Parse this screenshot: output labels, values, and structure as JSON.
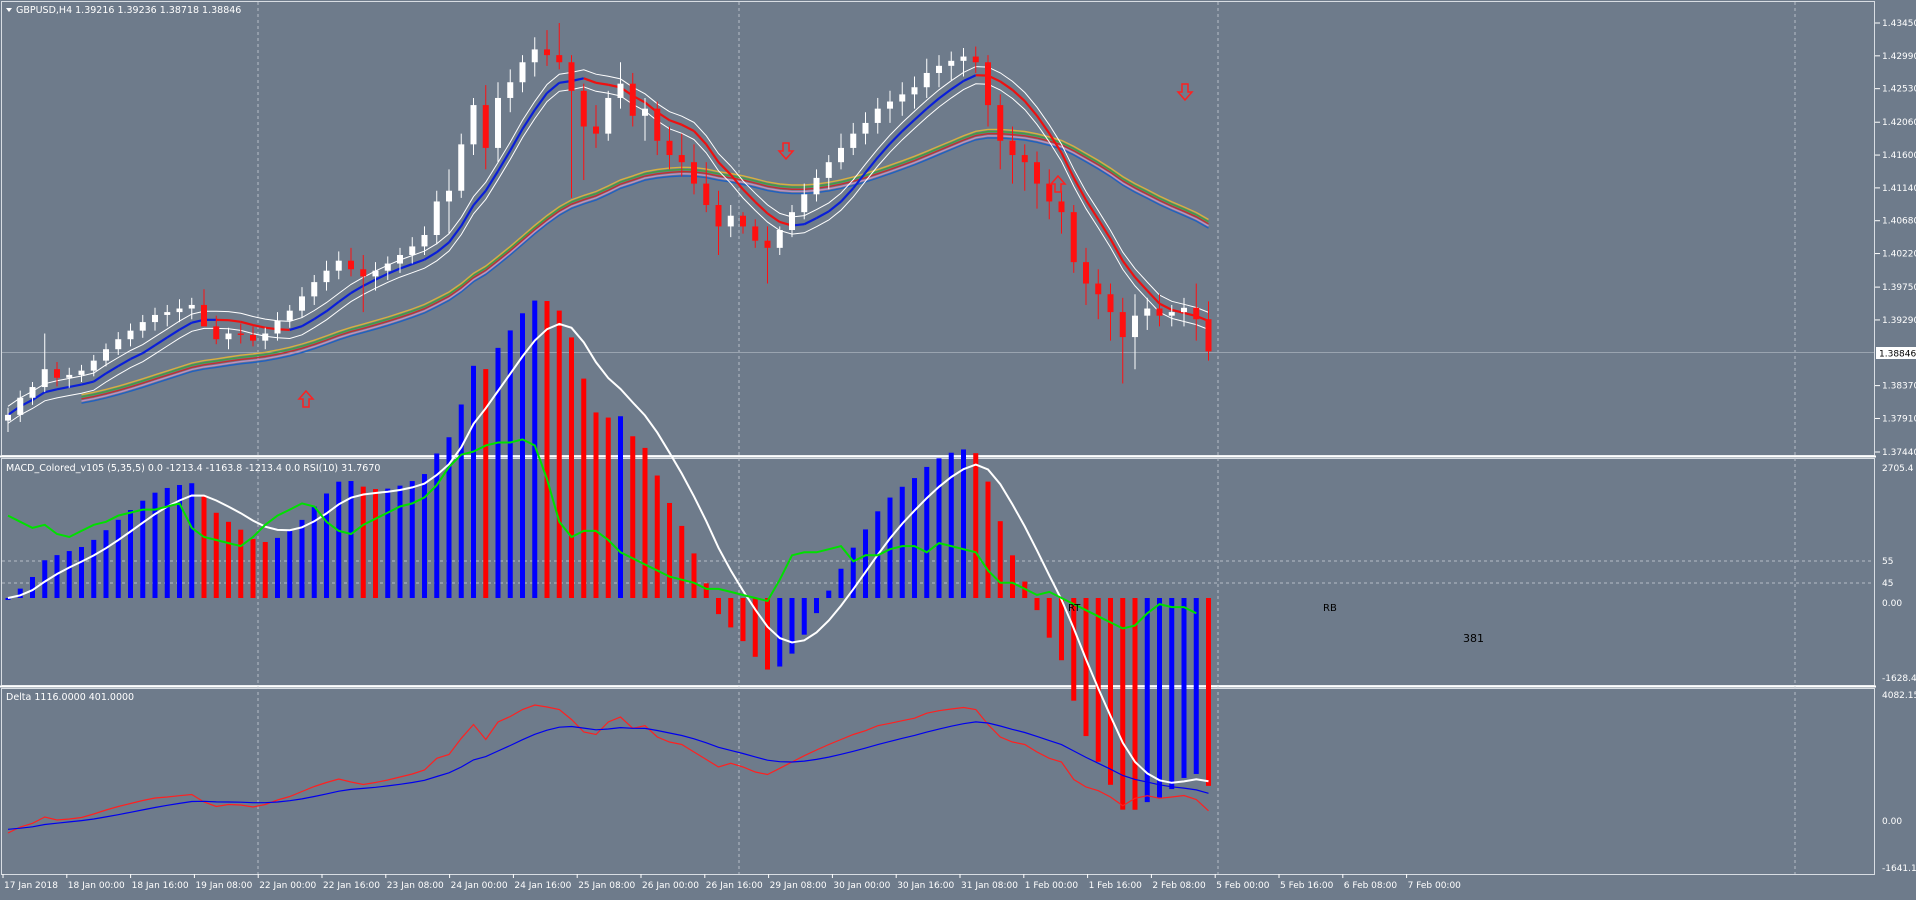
{
  "colors": {
    "background": "#6e7b8b",
    "grid": "#c8ced6",
    "bull_candle": "#ffffff",
    "bear_candle": "#ff1010",
    "macd_up": "#0000ff",
    "macd_down": "#ff0000",
    "rsi_line": "#00e000",
    "signal_line": "#ffffff",
    "delta_red": "#ff2020",
    "delta_blue": "#0000ee",
    "arrow": "#ff2020"
  },
  "main_panel": {
    "header": "GBPUSD,H4  1.39216 1.39236 1.38718 1.38846",
    "current_price_label": "1.38846",
    "y_ticks": [
      "1.43450",
      "1.42990",
      "1.42530",
      "1.42060",
      "1.41600",
      "1.41140",
      "1.40680",
      "1.40220",
      "1.39750",
      "1.39290",
      "1.38846",
      "1.38370",
      "1.37910",
      "1.37440"
    ],
    "y_min": 1.3744,
    "y_max": 1.4345
  },
  "macd_panel": {
    "header": "MACD_Colored_v105 (5,35,5) 0.0 -1213.4 -1163.8 -1213.4 0.0  RSI(10) 31.7670",
    "y_ticks": [
      "2705.4",
      "55",
      "45",
      "0.00",
      "-1628.4"
    ],
    "annotations": [
      "RT",
      "RB",
      "381"
    ]
  },
  "delta_panel": {
    "header": "Delta 1116.0000 401.0000",
    "y_ticks": [
      "4082.15",
      "0.00",
      "-1641.15"
    ]
  },
  "time_axis": {
    "labels": [
      "17 Jan 2018",
      "18 Jan 00:00",
      "18 Jan 16:00",
      "19 Jan 08:00",
      "22 Jan 00:00",
      "22 Jan 16:00",
      "23 Jan 08:00",
      "24 Jan 00:00",
      "24 Jan 16:00",
      "25 Jan 08:00",
      "26 Jan 00:00",
      "26 Jan 16:00",
      "29 Jan 08:00",
      "30 Jan 00:00",
      "30 Jan 16:00",
      "31 Jan 08:00",
      "1 Feb 00:00",
      "1 Feb 16:00",
      "2 Feb 08:00",
      "5 Feb 00:00",
      "5 Feb 16:00",
      "6 Feb 08:00",
      "7 Feb 00:00"
    ]
  },
  "chart_data": {
    "type": "candlestick",
    "symbol": "GBPUSD",
    "timeframe": "H4",
    "ohlc": [
      [
        1.3788,
        1.3806,
        1.3772,
        1.3796
      ],
      [
        1.3796,
        1.383,
        1.3786,
        1.382
      ],
      [
        1.382,
        1.3842,
        1.381,
        1.3835
      ],
      [
        1.3835,
        1.391,
        1.3828,
        1.386
      ],
      [
        1.386,
        1.387,
        1.3836,
        1.3848
      ],
      [
        1.3848,
        1.3862,
        1.3834,
        1.3852
      ],
      [
        1.3852,
        1.3866,
        1.3842,
        1.3858
      ],
      [
        1.3858,
        1.388,
        1.385,
        1.3872
      ],
      [
        1.3872,
        1.3896,
        1.3864,
        1.3888
      ],
      [
        1.3888,
        1.3912,
        1.388,
        1.3902
      ],
      [
        1.3902,
        1.3924,
        1.3892,
        1.3914
      ],
      [
        1.3914,
        1.3936,
        1.3904,
        1.3926
      ],
      [
        1.3926,
        1.3946,
        1.3914,
        1.3936
      ],
      [
        1.3936,
        1.395,
        1.392,
        1.394
      ],
      [
        1.394,
        1.3958,
        1.3926,
        1.3945
      ],
      [
        1.3945,
        1.396,
        1.393,
        1.395
      ],
      [
        1.395,
        1.3972,
        1.3935,
        1.392
      ],
      [
        1.392,
        1.3935,
        1.3895,
        1.3902
      ],
      [
        1.3902,
        1.3918,
        1.3888,
        1.391
      ],
      [
        1.391,
        1.3924,
        1.3896,
        1.3908
      ],
      [
        1.3908,
        1.392,
        1.3892,
        1.39
      ],
      [
        1.39,
        1.3918,
        1.3888,
        1.391
      ],
      [
        1.391,
        1.394,
        1.39,
        1.3928
      ],
      [
        1.3928,
        1.395,
        1.3918,
        1.3942
      ],
      [
        1.3942,
        1.3975,
        1.3932,
        1.3962
      ],
      [
        1.3962,
        1.3992,
        1.395,
        1.3982
      ],
      [
        1.3982,
        1.4012,
        1.397,
        1.3998
      ],
      [
        1.3998,
        1.4025,
        1.3986,
        1.4012
      ],
      [
        1.4012,
        1.403,
        1.399,
        1.4
      ],
      [
        1.4,
        1.402,
        1.394,
        1.399
      ],
      [
        1.399,
        1.401,
        1.397,
        1.3998
      ],
      [
        1.3998,
        1.4018,
        1.3985,
        1.4008
      ],
      [
        1.4008,
        1.403,
        1.3995,
        1.402
      ],
      [
        1.402,
        1.4045,
        1.4008,
        1.4032
      ],
      [
        1.4032,
        1.406,
        1.402,
        1.4048
      ],
      [
        1.4048,
        1.411,
        1.4035,
        1.4095
      ],
      [
        1.4095,
        1.414,
        1.405,
        1.411
      ],
      [
        1.411,
        1.419,
        1.41,
        1.4175
      ],
      [
        1.4175,
        1.424,
        1.416,
        1.423
      ],
      [
        1.423,
        1.4258,
        1.414,
        1.417
      ],
      [
        1.417,
        1.4262,
        1.415,
        1.424
      ],
      [
        1.424,
        1.428,
        1.422,
        1.4262
      ],
      [
        1.4262,
        1.43,
        1.4248,
        1.429
      ],
      [
        1.429,
        1.4325,
        1.427,
        1.4308
      ],
      [
        1.4308,
        1.4335,
        1.4285,
        1.43
      ],
      [
        1.43,
        1.4345,
        1.428,
        1.429
      ],
      [
        1.429,
        1.43,
        1.41,
        1.425
      ],
      [
        1.425,
        1.426,
        1.4125,
        1.42
      ],
      [
        1.42,
        1.423,
        1.417,
        1.419
      ],
      [
        1.419,
        1.425,
        1.418,
        1.424
      ],
      [
        1.424,
        1.429,
        1.4225,
        1.426
      ],
      [
        1.426,
        1.4275,
        1.42,
        1.4215
      ],
      [
        1.4215,
        1.424,
        1.418,
        1.4225
      ],
      [
        1.4225,
        1.4235,
        1.416,
        1.418
      ],
      [
        1.418,
        1.42,
        1.414,
        1.416
      ],
      [
        1.416,
        1.419,
        1.413,
        1.415
      ],
      [
        1.415,
        1.4175,
        1.4105,
        1.412
      ],
      [
        1.412,
        1.415,
        1.408,
        1.409
      ],
      [
        1.409,
        1.411,
        1.402,
        1.406
      ],
      [
        1.406,
        1.409,
        1.4045,
        1.4075
      ],
      [
        1.4075,
        1.408,
        1.405,
        1.406
      ],
      [
        1.406,
        1.407,
        1.403,
        1.404
      ],
      [
        1.404,
        1.406,
        1.398,
        1.403
      ],
      [
        1.403,
        1.406,
        1.402,
        1.4055
      ],
      [
        1.4055,
        1.409,
        1.4045,
        1.408
      ],
      [
        1.408,
        1.412,
        1.407,
        1.4105
      ],
      [
        1.4105,
        1.414,
        1.4095,
        1.4128
      ],
      [
        1.4128,
        1.416,
        1.4112,
        1.415
      ],
      [
        1.415,
        1.419,
        1.414,
        1.417
      ],
      [
        1.417,
        1.4205,
        1.416,
        1.419
      ],
      [
        1.419,
        1.422,
        1.4175,
        1.4205
      ],
      [
        1.4205,
        1.424,
        1.419,
        1.4225
      ],
      [
        1.4225,
        1.425,
        1.4205,
        1.4235
      ],
      [
        1.4235,
        1.4262,
        1.4215,
        1.4245
      ],
      [
        1.4245,
        1.427,
        1.4225,
        1.4255
      ],
      [
        1.4255,
        1.4295,
        1.424,
        1.4275
      ],
      [
        1.4275,
        1.43,
        1.4255,
        1.4285
      ],
      [
        1.4285,
        1.4305,
        1.4265,
        1.4292
      ],
      [
        1.4292,
        1.431,
        1.427,
        1.4298
      ],
      [
        1.4298,
        1.4312,
        1.4275,
        1.429
      ],
      [
        1.429,
        1.43,
        1.42,
        1.423
      ],
      [
        1.423,
        1.4245,
        1.414,
        1.418
      ],
      [
        1.418,
        1.42,
        1.412,
        1.416
      ],
      [
        1.416,
        1.4175,
        1.411,
        1.415
      ],
      [
        1.415,
        1.4165,
        1.4085,
        1.412
      ],
      [
        1.412,
        1.414,
        1.407,
        1.4095
      ],
      [
        1.4095,
        1.411,
        1.405,
        1.408
      ],
      [
        1.408,
        1.409,
        1.3995,
        1.401
      ],
      [
        1.401,
        1.403,
        1.395,
        1.398
      ],
      [
        1.398,
        1.4,
        1.393,
        1.3965
      ],
      [
        1.3965,
        1.398,
        1.39,
        1.394
      ],
      [
        1.394,
        1.396,
        1.384,
        1.3905
      ],
      [
        1.3905,
        1.3965,
        1.386,
        1.3935
      ],
      [
        1.3935,
        1.396,
        1.3915,
        1.3945
      ],
      [
        1.3945,
        1.3965,
        1.392,
        1.3935
      ],
      [
        1.3935,
        1.395,
        1.392,
        1.394
      ],
      [
        1.394,
        1.396,
        1.392,
        1.3946
      ],
      [
        1.3946,
        1.398,
        1.39,
        1.393
      ],
      [
        1.393,
        1.3955,
        1.3872,
        1.3885
      ]
    ],
    "rsi": [
      62,
      60,
      58,
      59,
      56,
      55,
      57,
      59,
      60,
      62,
      63,
      64,
      64,
      65,
      66,
      58,
      55,
      54,
      53,
      52,
      55,
      59,
      62,
      64,
      66,
      65,
      60,
      57,
      56,
      59,
      61,
      63,
      65,
      66,
      68,
      72,
      78,
      82,
      83,
      85,
      86,
      86,
      87,
      85,
      74,
      60,
      55,
      57,
      57,
      54,
      50,
      48,
      46,
      44,
      42,
      41,
      40,
      38,
      38,
      37,
      36,
      35,
      34,
      41,
      49,
      50,
      50,
      51,
      52,
      47,
      49,
      49,
      51,
      52,
      52,
      50,
      53,
      52,
      51,
      50,
      44,
      40,
      40,
      38,
      36,
      37,
      35,
      33,
      31,
      29,
      27,
      25,
      26,
      30,
      33,
      32,
      32,
      30
    ]
  }
}
